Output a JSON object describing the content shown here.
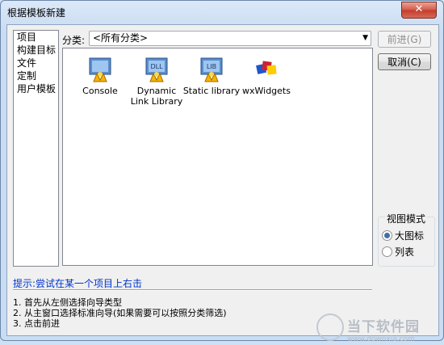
{
  "window": {
    "title": "根据模板新建",
    "close_symbol": "✕"
  },
  "categories": [
    "项目",
    "构建目标",
    "文件",
    "定制",
    "用户模板"
  ],
  "filter": {
    "label": "分类:",
    "value": "<所有分类>"
  },
  "templates": [
    {
      "label": "Console",
      "icon": "console-icon"
    },
    {
      "label": "Dynamic Link Library",
      "icon": "dll-icon",
      "badge": "DLL"
    },
    {
      "label": "Static library",
      "icon": "static-library-icon",
      "badge": "LIB"
    },
    {
      "label": "wxWidgets",
      "icon": "wxwidgets-icon"
    }
  ],
  "buttons": {
    "next": "前进(G)",
    "cancel": "取消(C)"
  },
  "view_mode": {
    "title": "视图模式",
    "options": [
      "大图标",
      "列表"
    ],
    "selected": "大图标"
  },
  "hint": "提示:尝试在某一个项目上右击",
  "steps": [
    "1. 首先从左侧选择向导类型",
    "2. 从主窗口选择标准向导(如果需要可以按照分类筛选)",
    "3. 点击前进"
  ],
  "watermark": {
    "text": "当下软件园",
    "url": "www.downxia.com"
  },
  "colors": {
    "hint": "#0033cc",
    "title_bar": "#dbe8f8",
    "close_button": "#c23b2b"
  }
}
